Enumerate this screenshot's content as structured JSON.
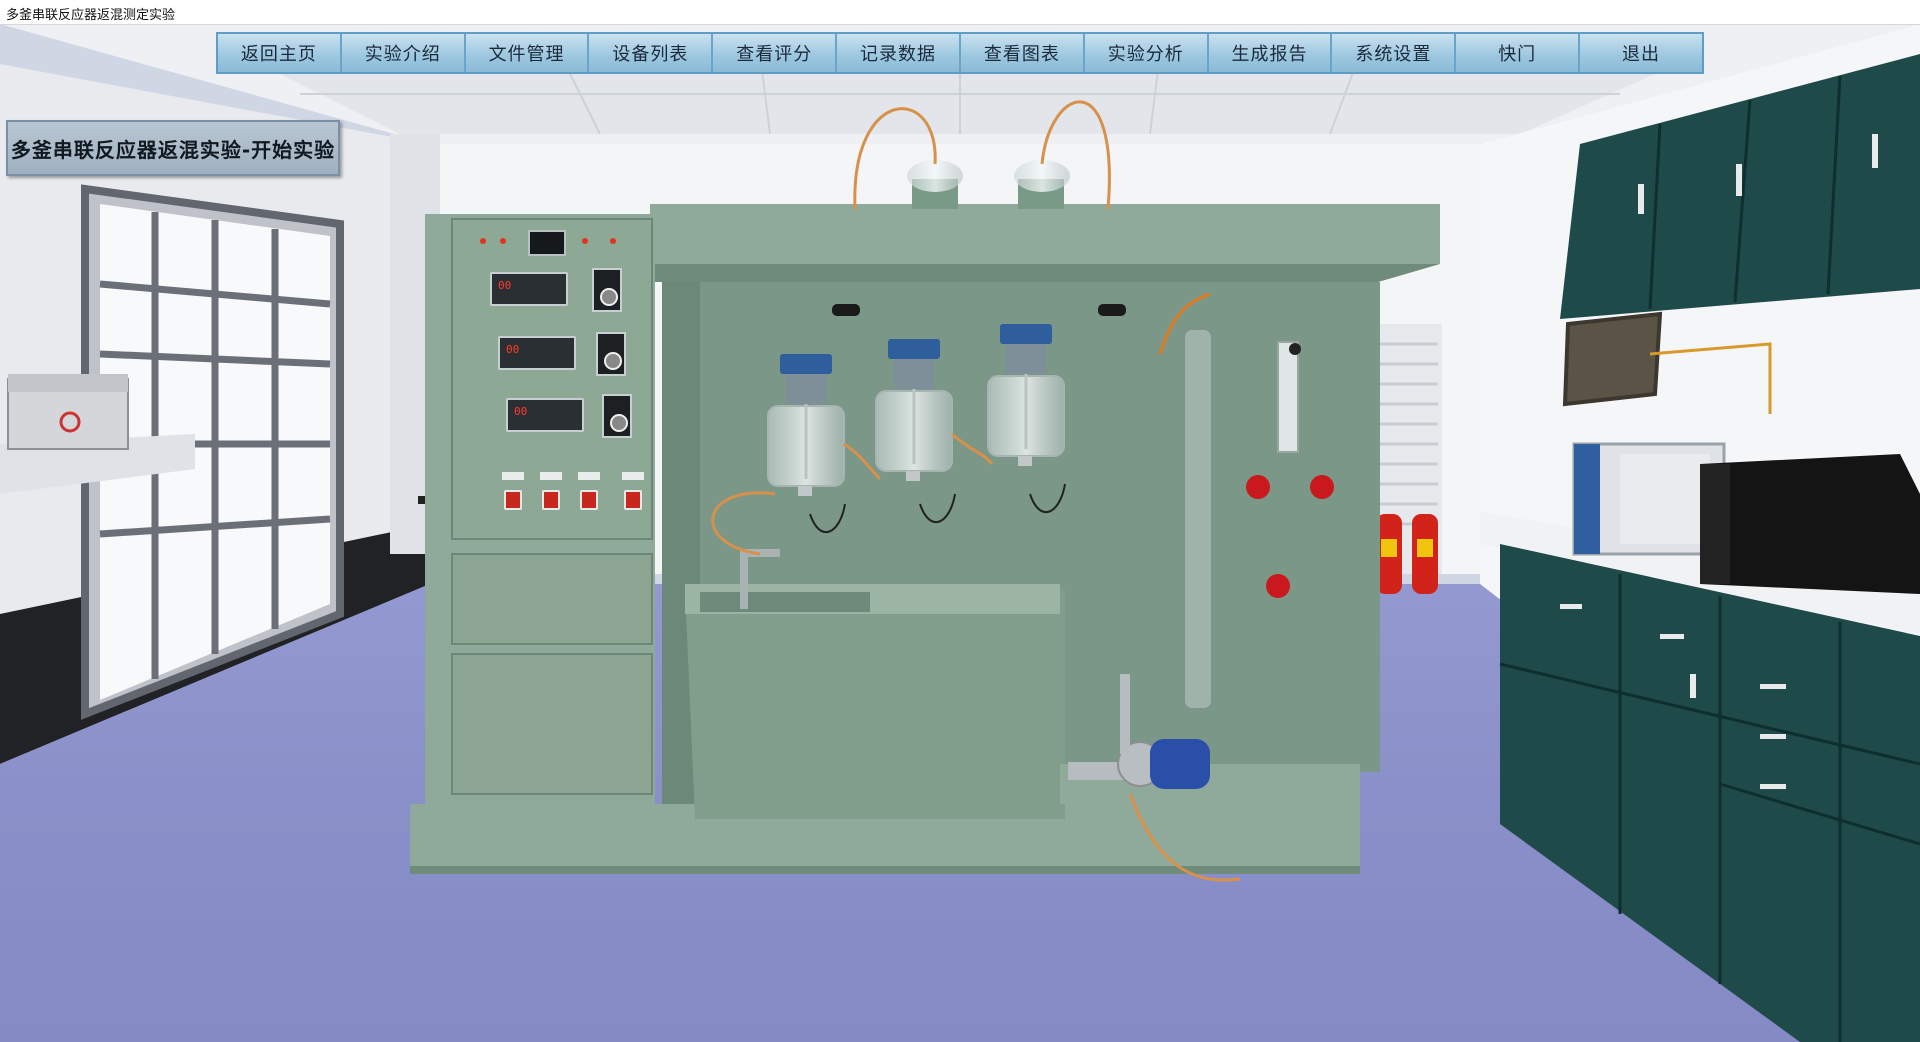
{
  "window": {
    "title": "多釜串联反应器返混测定实验"
  },
  "menu": {
    "items": [
      {
        "label": "返回主页",
        "name": "menu-home"
      },
      {
        "label": "实验介绍",
        "name": "menu-intro"
      },
      {
        "label": "文件管理",
        "name": "menu-files"
      },
      {
        "label": "设备列表",
        "name": "menu-equipment"
      },
      {
        "label": "查看评分",
        "name": "menu-score"
      },
      {
        "label": "记录数据",
        "name": "menu-record"
      },
      {
        "label": "查看图表",
        "name": "menu-chart"
      },
      {
        "label": "实验分析",
        "name": "menu-analysis"
      },
      {
        "label": "生成报告",
        "name": "menu-report"
      },
      {
        "label": "系统设置",
        "name": "menu-settings"
      },
      {
        "label": "快门",
        "name": "menu-shutter"
      },
      {
        "label": "退出",
        "name": "menu-exit"
      }
    ]
  },
  "experiment": {
    "start_label": "多釜串联反应器返混实验-开始实验"
  },
  "colors": {
    "menu_bg": "#8fbfd8",
    "equipment_green": "#8faa9a",
    "floor": "#8a8fc8",
    "extinguisher": "#d2231b",
    "cabinet": "#1f4a4a",
    "valve": "#c9191f",
    "motor": "#2a4fa8"
  }
}
